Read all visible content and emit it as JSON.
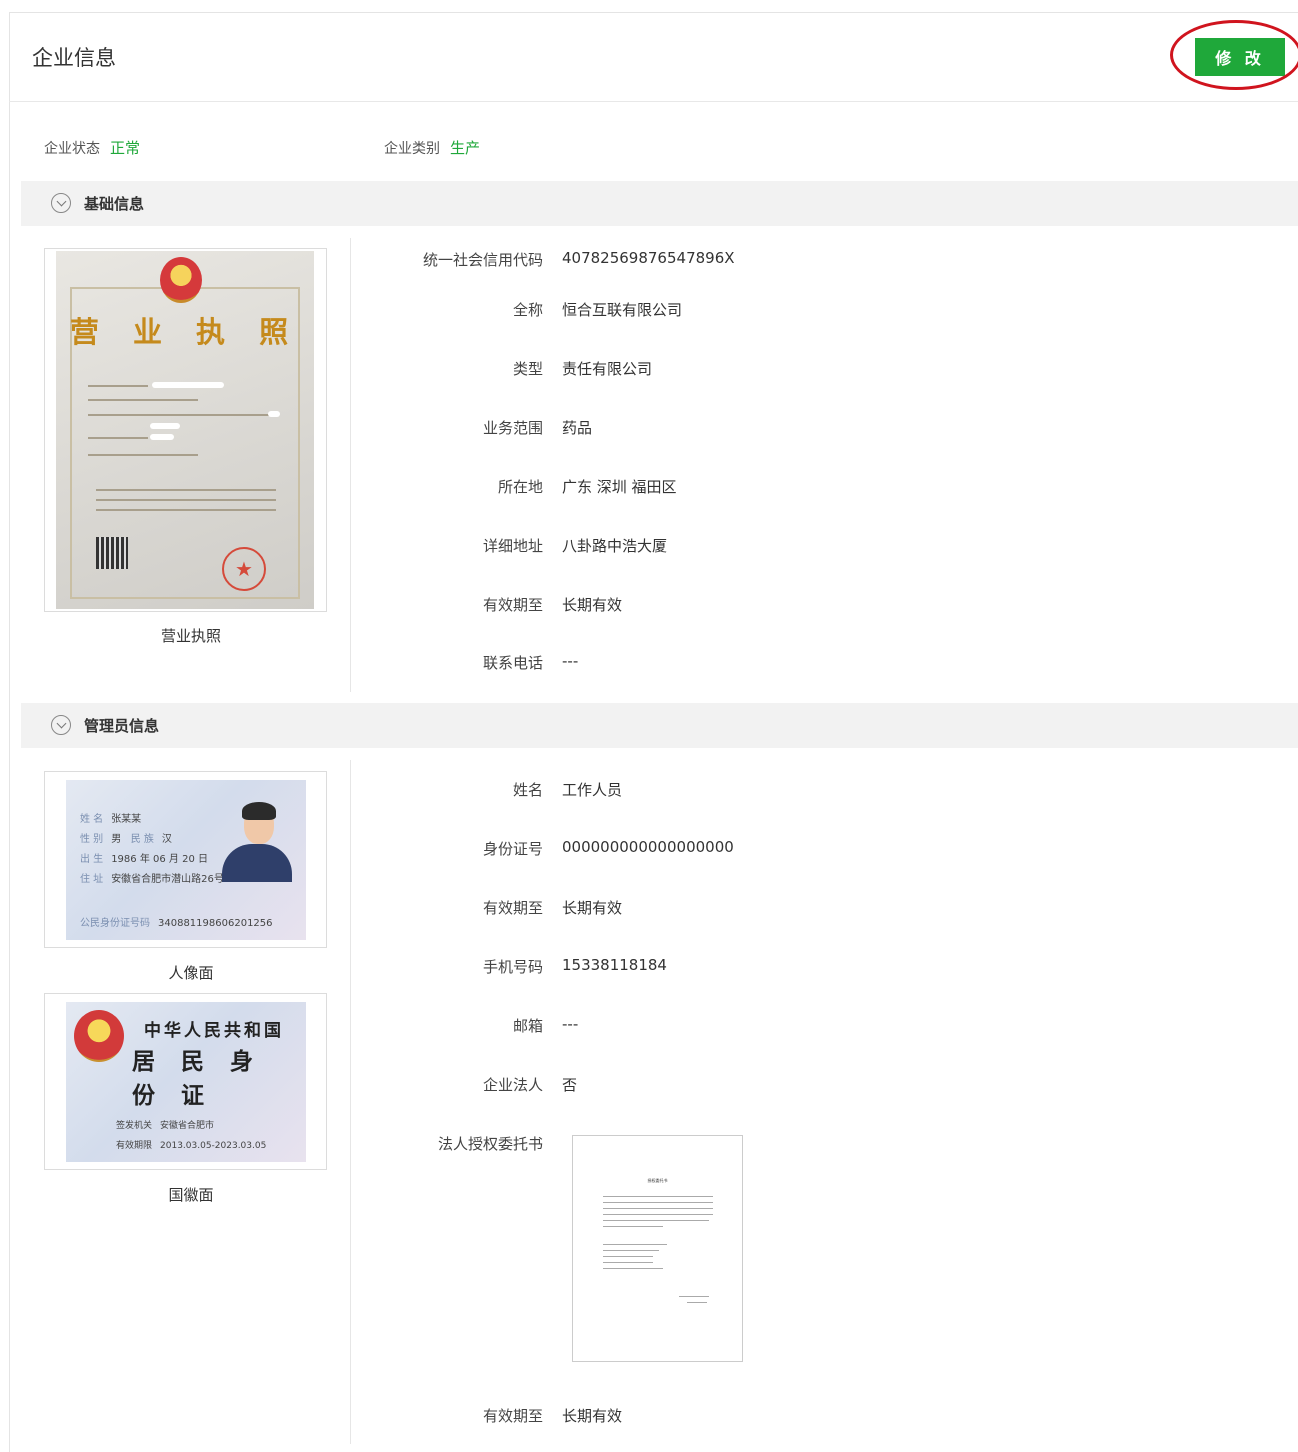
{
  "header": {
    "title": "企业信息",
    "edit_label": "修 改"
  },
  "status": {
    "state_label": "企业状态",
    "state_value": "正常",
    "category_label": "企业类别",
    "category_value": "生产"
  },
  "basic": {
    "section_title": "基础信息",
    "license_caption": "营业执照",
    "license_heading": "营 业 执 照",
    "fields": [
      {
        "label": "统一社会信用代码",
        "value": "40782569876547896X"
      },
      {
        "label": "全称",
        "value": "恒合互联有限公司"
      },
      {
        "label": "类型",
        "value": "责任有限公司"
      },
      {
        "label": "业务范围",
        "value": "药品"
      },
      {
        "label": "所在地",
        "value": "广东 深圳 福田区"
      },
      {
        "label": "详细地址",
        "value": "八卦路中浩大厦"
      },
      {
        "label": "有效期至",
        "value": "长期有效"
      },
      {
        "label": "联系电话",
        "value": "---"
      }
    ]
  },
  "admin": {
    "section_title": "管理员信息",
    "front_caption": "人像面",
    "back_caption": "国徽面",
    "id_front": {
      "name_label": "姓 名",
      "name": "张某某",
      "sex_label": "性 别",
      "sex": "男",
      "nation_label": "民 族",
      "nation": "汉",
      "birth_label": "出 生",
      "birth": "1986 年 06 月 20 日",
      "addr_label": "住 址",
      "addr": "安徽省合肥市潜山路26号",
      "id_label": "公民身份证号码",
      "id": "340881198606201256"
    },
    "id_back": {
      "line1": "中华人民共和国",
      "line2": "居 民 身 份 证",
      "authority_label": "签发机关",
      "authority": "安徽省合肥市",
      "valid_label": "有效期限",
      "valid": "2013.03.05-2023.03.05"
    },
    "fields": [
      {
        "label": "姓名",
        "value": "工作人员"
      },
      {
        "label": "身份证号",
        "value": "000000000000000000"
      },
      {
        "label": "有效期至",
        "value": "长期有效"
      },
      {
        "label": "手机号码",
        "value": "15338118184"
      },
      {
        "label": "邮箱",
        "value": "---"
      },
      {
        "label": "企业法人",
        "value": "否"
      }
    ],
    "auth_label": "法人授权委托书",
    "auth_title": "授权委托书",
    "auth_valid_label": "有效期至",
    "auth_valid_value": "长期有效"
  }
}
